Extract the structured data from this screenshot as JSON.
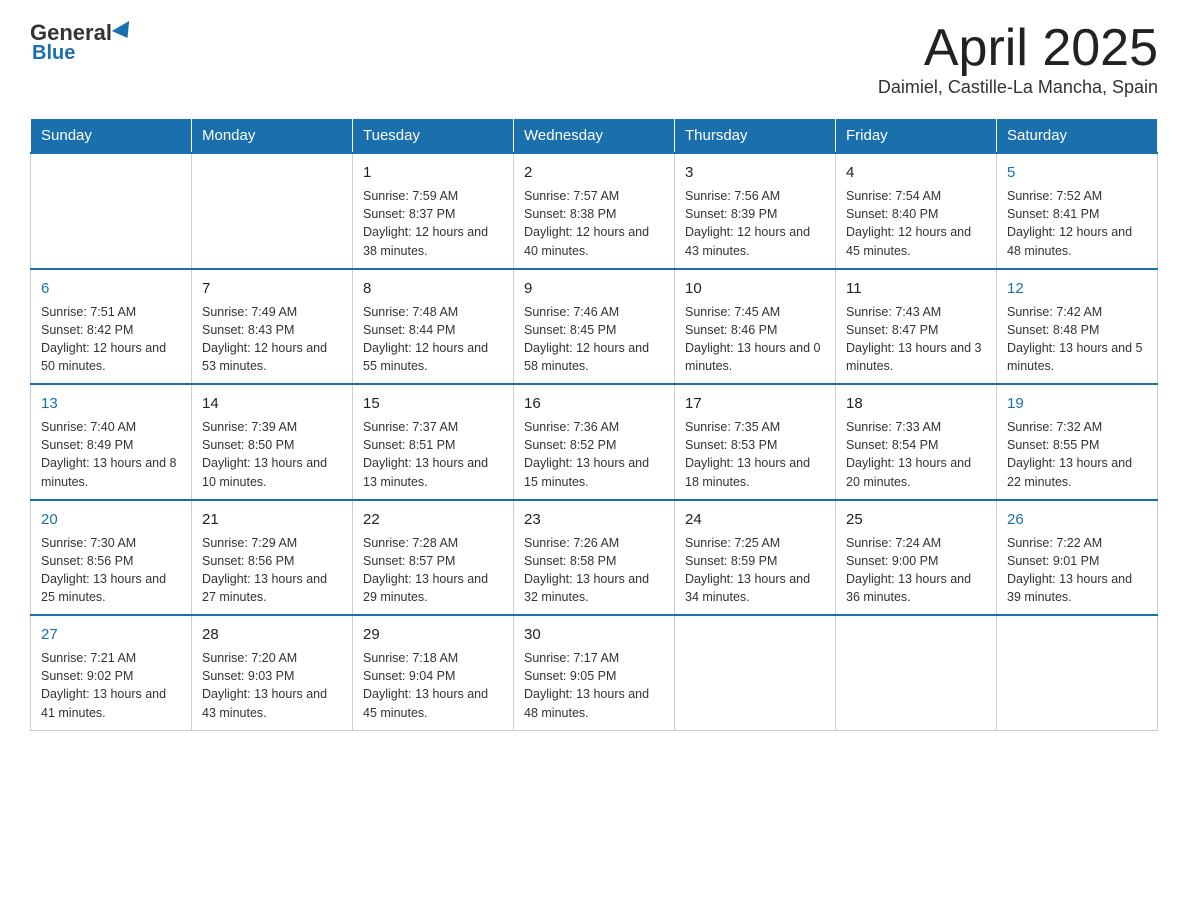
{
  "header": {
    "logo": {
      "general": "General",
      "triangle": "",
      "blue": "Blue"
    },
    "title": "April 2025",
    "location": "Daimiel, Castille-La Mancha, Spain"
  },
  "calendar": {
    "headers": [
      "Sunday",
      "Monday",
      "Tuesday",
      "Wednesday",
      "Thursday",
      "Friday",
      "Saturday"
    ],
    "weeks": [
      [
        {
          "day": "",
          "sunrise": "",
          "sunset": "",
          "daylight": ""
        },
        {
          "day": "",
          "sunrise": "",
          "sunset": "",
          "daylight": ""
        },
        {
          "day": "1",
          "sunrise": "Sunrise: 7:59 AM",
          "sunset": "Sunset: 8:37 PM",
          "daylight": "Daylight: 12 hours and 38 minutes."
        },
        {
          "day": "2",
          "sunrise": "Sunrise: 7:57 AM",
          "sunset": "Sunset: 8:38 PM",
          "daylight": "Daylight: 12 hours and 40 minutes."
        },
        {
          "day": "3",
          "sunrise": "Sunrise: 7:56 AM",
          "sunset": "Sunset: 8:39 PM",
          "daylight": "Daylight: 12 hours and 43 minutes."
        },
        {
          "day": "4",
          "sunrise": "Sunrise: 7:54 AM",
          "sunset": "Sunset: 8:40 PM",
          "daylight": "Daylight: 12 hours and 45 minutes."
        },
        {
          "day": "5",
          "sunrise": "Sunrise: 7:52 AM",
          "sunset": "Sunset: 8:41 PM",
          "daylight": "Daylight: 12 hours and 48 minutes."
        }
      ],
      [
        {
          "day": "6",
          "sunrise": "Sunrise: 7:51 AM",
          "sunset": "Sunset: 8:42 PM",
          "daylight": "Daylight: 12 hours and 50 minutes."
        },
        {
          "day": "7",
          "sunrise": "Sunrise: 7:49 AM",
          "sunset": "Sunset: 8:43 PM",
          "daylight": "Daylight: 12 hours and 53 minutes."
        },
        {
          "day": "8",
          "sunrise": "Sunrise: 7:48 AM",
          "sunset": "Sunset: 8:44 PM",
          "daylight": "Daylight: 12 hours and 55 minutes."
        },
        {
          "day": "9",
          "sunrise": "Sunrise: 7:46 AM",
          "sunset": "Sunset: 8:45 PM",
          "daylight": "Daylight: 12 hours and 58 minutes."
        },
        {
          "day": "10",
          "sunrise": "Sunrise: 7:45 AM",
          "sunset": "Sunset: 8:46 PM",
          "daylight": "Daylight: 13 hours and 0 minutes."
        },
        {
          "day": "11",
          "sunrise": "Sunrise: 7:43 AM",
          "sunset": "Sunset: 8:47 PM",
          "daylight": "Daylight: 13 hours and 3 minutes."
        },
        {
          "day": "12",
          "sunrise": "Sunrise: 7:42 AM",
          "sunset": "Sunset: 8:48 PM",
          "daylight": "Daylight: 13 hours and 5 minutes."
        }
      ],
      [
        {
          "day": "13",
          "sunrise": "Sunrise: 7:40 AM",
          "sunset": "Sunset: 8:49 PM",
          "daylight": "Daylight: 13 hours and 8 minutes."
        },
        {
          "day": "14",
          "sunrise": "Sunrise: 7:39 AM",
          "sunset": "Sunset: 8:50 PM",
          "daylight": "Daylight: 13 hours and 10 minutes."
        },
        {
          "day": "15",
          "sunrise": "Sunrise: 7:37 AM",
          "sunset": "Sunset: 8:51 PM",
          "daylight": "Daylight: 13 hours and 13 minutes."
        },
        {
          "day": "16",
          "sunrise": "Sunrise: 7:36 AM",
          "sunset": "Sunset: 8:52 PM",
          "daylight": "Daylight: 13 hours and 15 minutes."
        },
        {
          "day": "17",
          "sunrise": "Sunrise: 7:35 AM",
          "sunset": "Sunset: 8:53 PM",
          "daylight": "Daylight: 13 hours and 18 minutes."
        },
        {
          "day": "18",
          "sunrise": "Sunrise: 7:33 AM",
          "sunset": "Sunset: 8:54 PM",
          "daylight": "Daylight: 13 hours and 20 minutes."
        },
        {
          "day": "19",
          "sunrise": "Sunrise: 7:32 AM",
          "sunset": "Sunset: 8:55 PM",
          "daylight": "Daylight: 13 hours and 22 minutes."
        }
      ],
      [
        {
          "day": "20",
          "sunrise": "Sunrise: 7:30 AM",
          "sunset": "Sunset: 8:56 PM",
          "daylight": "Daylight: 13 hours and 25 minutes."
        },
        {
          "day": "21",
          "sunrise": "Sunrise: 7:29 AM",
          "sunset": "Sunset: 8:56 PM",
          "daylight": "Daylight: 13 hours and 27 minutes."
        },
        {
          "day": "22",
          "sunrise": "Sunrise: 7:28 AM",
          "sunset": "Sunset: 8:57 PM",
          "daylight": "Daylight: 13 hours and 29 minutes."
        },
        {
          "day": "23",
          "sunrise": "Sunrise: 7:26 AM",
          "sunset": "Sunset: 8:58 PM",
          "daylight": "Daylight: 13 hours and 32 minutes."
        },
        {
          "day": "24",
          "sunrise": "Sunrise: 7:25 AM",
          "sunset": "Sunset: 8:59 PM",
          "daylight": "Daylight: 13 hours and 34 minutes."
        },
        {
          "day": "25",
          "sunrise": "Sunrise: 7:24 AM",
          "sunset": "Sunset: 9:00 PM",
          "daylight": "Daylight: 13 hours and 36 minutes."
        },
        {
          "day": "26",
          "sunrise": "Sunrise: 7:22 AM",
          "sunset": "Sunset: 9:01 PM",
          "daylight": "Daylight: 13 hours and 39 minutes."
        }
      ],
      [
        {
          "day": "27",
          "sunrise": "Sunrise: 7:21 AM",
          "sunset": "Sunset: 9:02 PM",
          "daylight": "Daylight: 13 hours and 41 minutes."
        },
        {
          "day": "28",
          "sunrise": "Sunrise: 7:20 AM",
          "sunset": "Sunset: 9:03 PM",
          "daylight": "Daylight: 13 hours and 43 minutes."
        },
        {
          "day": "29",
          "sunrise": "Sunrise: 7:18 AM",
          "sunset": "Sunset: 9:04 PM",
          "daylight": "Daylight: 13 hours and 45 minutes."
        },
        {
          "day": "30",
          "sunrise": "Sunrise: 7:17 AM",
          "sunset": "Sunset: 9:05 PM",
          "daylight": "Daylight: 13 hours and 48 minutes."
        },
        {
          "day": "",
          "sunrise": "",
          "sunset": "",
          "daylight": ""
        },
        {
          "day": "",
          "sunrise": "",
          "sunset": "",
          "daylight": ""
        },
        {
          "day": "",
          "sunrise": "",
          "sunset": "",
          "daylight": ""
        }
      ]
    ]
  }
}
